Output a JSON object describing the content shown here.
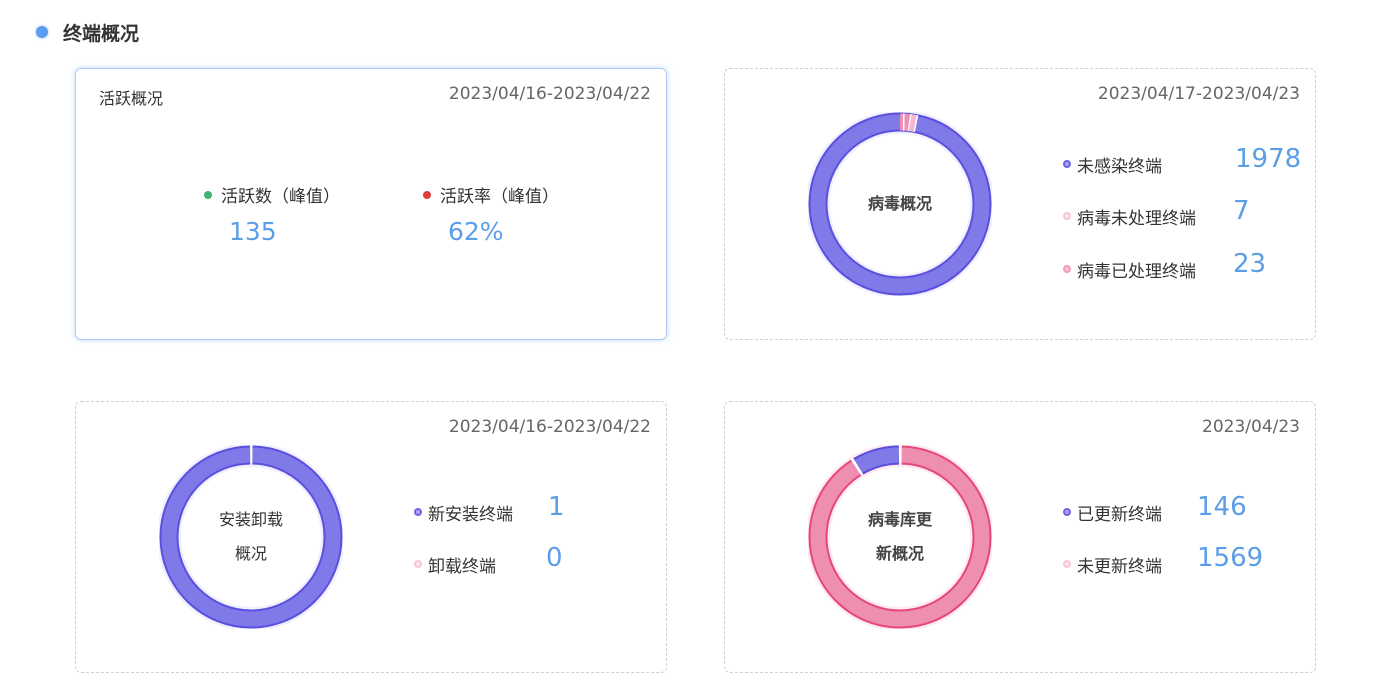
{
  "section": {
    "title": "终端概况"
  },
  "activity": {
    "title": "活跃概况",
    "date": "2023/04/16-2023/04/22",
    "stats": [
      {
        "label": "活跃数（峰值）",
        "value": "135",
        "dot_color": "#3cb371"
      },
      {
        "label": "活跃率（峰值）",
        "value": "62%",
        "dot_color": "#e23b3b"
      }
    ]
  },
  "virus": {
    "date": "2023/04/17-2023/04/23",
    "center_lines": [
      "病毒概况"
    ],
    "legend": [
      {
        "label": "未感染终端",
        "value": "1978",
        "color": "#7b73e6"
      },
      {
        "label": "病毒未处理终端",
        "value": "7",
        "color": "#f5b8cf"
      },
      {
        "label": "病毒已处理终端",
        "value": "23",
        "color": "#ee8fb6"
      }
    ]
  },
  "install": {
    "date": "2023/04/16-2023/04/22",
    "center_lines": [
      "安装卸载",
      "概况"
    ],
    "legend": [
      {
        "label": "新安装终端",
        "value": "1",
        "color": "#7b73e6"
      },
      {
        "label": "卸载终端",
        "value": "0",
        "color": "#f5b8cf"
      }
    ]
  },
  "update": {
    "date": "2023/04/23",
    "center_lines": [
      "病毒库更",
      "新概况"
    ],
    "legend": [
      {
        "label": "已更新终端",
        "value": "146",
        "color": "#7b73e6"
      },
      {
        "label": "未更新终端",
        "value": "1569",
        "color": "#f5b8cf"
      }
    ]
  },
  "colors": {
    "accent_blue": "#5b9ee8",
    "ring_purple_fill": "#8079e8",
    "ring_purple_stroke": "#5a50e0",
    "ring_pink_fill": "#ee8fb1",
    "ring_pink_stroke": "#e5477c"
  }
}
